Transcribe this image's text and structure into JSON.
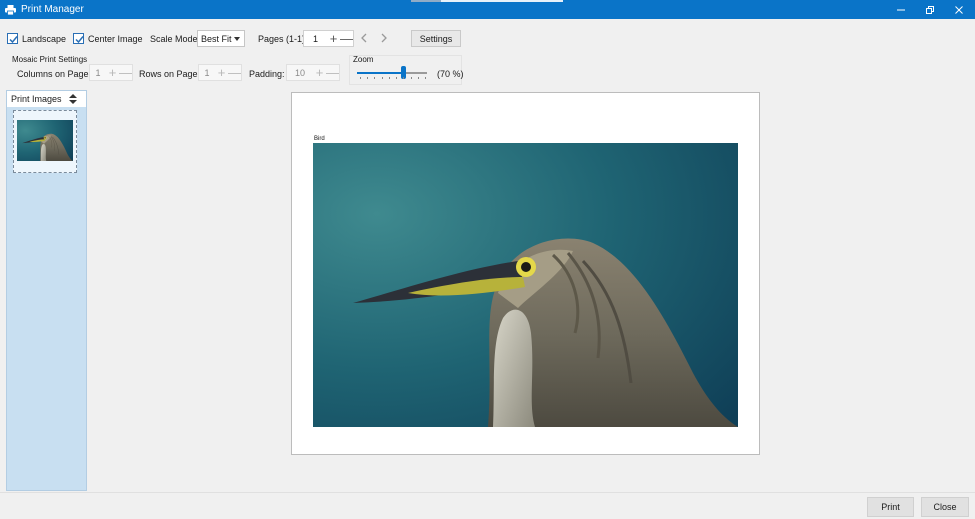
{
  "window": {
    "title": "Print Manager",
    "controls": [
      "minimize",
      "restore",
      "close"
    ]
  },
  "toolbar": {
    "landscape": {
      "label": "Landscape",
      "checked": true
    },
    "center_image": {
      "label": "Center Image",
      "checked": true
    },
    "scale_mode": {
      "label": "Scale Mode:",
      "value": "Best Fit"
    },
    "pages": {
      "label": "Pages (1-1):",
      "value": "1"
    },
    "settings_label": "Settings"
  },
  "mosaic": {
    "heading": "Mosaic Print Settings",
    "columns": {
      "label": "Columns on Page:",
      "value": "1"
    },
    "rows": {
      "label": "Rows on Page:",
      "value": "1"
    },
    "padding": {
      "label": "Padding:",
      "value": "10"
    }
  },
  "zoom": {
    "label": "Zoom",
    "value_text": "(70 %)",
    "level": 0.66
  },
  "sidebar": {
    "header": "Print Images"
  },
  "preview": {
    "image_label": "Bird"
  },
  "footer": {
    "print_label": "Print",
    "close_label": "Close"
  },
  "colors": {
    "accent": "#0a74c8",
    "sidebar": "#c8dff1"
  }
}
